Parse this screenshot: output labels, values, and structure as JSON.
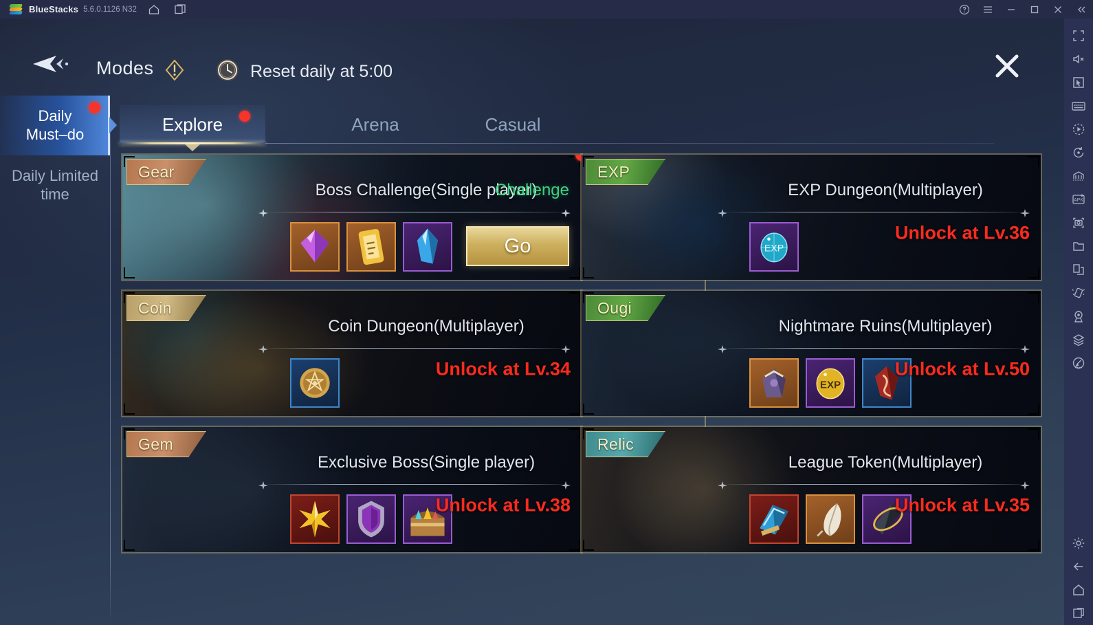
{
  "bluestacks": {
    "app_name": "BlueStacks",
    "version": "5.6.0.1126 N32",
    "titlebar_icons": [
      "home-icon",
      "multi-instance-icon"
    ],
    "window_controls": [
      "help-icon",
      "menu-icon",
      "minimize-icon",
      "maximize-icon",
      "close-icon",
      "collapse-icon"
    ]
  },
  "rail": {
    "items": [
      "fullscreen-icon",
      "mute-icon",
      "pointer-icon",
      "keyboard-icon",
      "macro-record-icon",
      "sync-rotate-icon",
      "game-controls-icon",
      "install-apk-icon",
      "screenshot-icon",
      "media-folder-icon",
      "multi-instance-icon",
      "shake-icon",
      "location-icon",
      "layers-icon",
      "gyroscope-icon"
    ],
    "bottom_items": [
      "settings-gear-icon",
      "back-icon",
      "home-icon",
      "recent-apps-icon"
    ]
  },
  "header": {
    "back_label": "back-arrow-icon",
    "title": "Modes",
    "warning_icon": "exclamation-diamond-icon",
    "clock_icon": "clock-icon",
    "reset_text": "Reset daily at 5:00",
    "close_label": "close-icon"
  },
  "sidebar": {
    "items": [
      {
        "label": "Daily Must-do",
        "line1": "Daily",
        "line2": "Must–do",
        "active": true,
        "badge": true
      },
      {
        "label": "Daily Limited time",
        "line1": "Daily Limited",
        "line2": "time",
        "active": false,
        "badge": false
      }
    ]
  },
  "tabs": [
    {
      "label": "Explore",
      "active": true,
      "badge": true
    },
    {
      "label": "Arena",
      "active": false,
      "badge": false
    },
    {
      "label": "Casual",
      "active": false,
      "badge": false
    }
  ],
  "cards": [
    {
      "ribbon": "Gear",
      "ribbon_style": "gear",
      "title": "Boss Challenge(Single player)",
      "status_type": "challenge",
      "status_text": "Challenge",
      "action_label": "Go",
      "badge": true,
      "items": [
        {
          "name": "purple-gem-reward",
          "quality": "q-orange"
        },
        {
          "name": "gear-scroll-reward",
          "quality": "q-orange"
        },
        {
          "name": "blue-crystal-reward",
          "quality": "q-purple"
        }
      ]
    },
    {
      "ribbon": "EXP",
      "ribbon_style": "exp",
      "title": "EXP Dungeon(Multiplayer)",
      "status_type": "locked",
      "status_text": "Unlock at Lv.36",
      "badge": false,
      "items": [
        {
          "name": "exp-orb-reward",
          "quality": "q-purple"
        }
      ]
    },
    {
      "ribbon": "Coin",
      "ribbon_style": "coin",
      "title": "Coin Dungeon(Multiplayer)",
      "status_type": "locked",
      "status_text": "Unlock at Lv.34",
      "badge": false,
      "items": [
        {
          "name": "gold-coin-reward",
          "quality": "q-blue"
        }
      ]
    },
    {
      "ribbon": "Ougi",
      "ribbon_style": "ougi",
      "title": "Nightmare Ruins(Multiplayer)",
      "status_type": "locked",
      "status_text": "Unlock at Lv.50",
      "badge": false,
      "items": [
        {
          "name": "ougi-relic-reward",
          "quality": "q-orange"
        },
        {
          "name": "exp-coin-reward",
          "quality": "q-purple"
        },
        {
          "name": "red-shard-reward",
          "quality": "q-blue"
        }
      ]
    },
    {
      "ribbon": "Gem",
      "ribbon_style": "gem",
      "title": "Exclusive Boss(Single player)",
      "status_type": "locked",
      "status_text": "Unlock at Lv.38",
      "badge": false,
      "items": [
        {
          "name": "gold-star-reward",
          "quality": "q-red"
        },
        {
          "name": "purple-shield-reward",
          "quality": "q-purple"
        },
        {
          "name": "treasure-chest-reward",
          "quality": "q-purple"
        }
      ]
    },
    {
      "ribbon": "Relic",
      "ribbon_style": "relic",
      "title": "League Token(Multiplayer)",
      "status_type": "locked",
      "status_text": "Unlock at Lv.35",
      "badge": false,
      "items": [
        {
          "name": "blue-book-reward",
          "quality": "q-red"
        },
        {
          "name": "white-feather-reward",
          "quality": "q-orange"
        },
        {
          "name": "dark-crystal-reward",
          "quality": "q-purple"
        }
      ]
    }
  ],
  "colors": {
    "accent_gold": "#e7d7a4",
    "locked_red": "#fc2b1e",
    "challenge_green": "#3ed07f",
    "badge_red": "#f5342a",
    "sidebar_active": "#27529c",
    "bluestacks_bar": "#262c47",
    "rail_bg": "#2a3152"
  }
}
